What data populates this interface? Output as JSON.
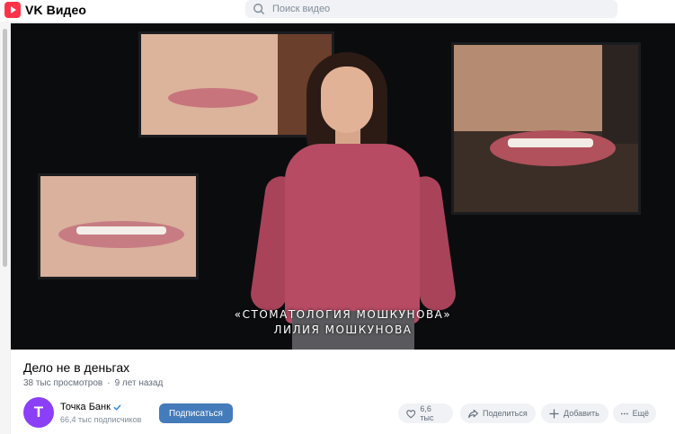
{
  "app": {
    "name": "VK Видео"
  },
  "search": {
    "placeholder": "Поиск видео"
  },
  "player": {
    "subtitle_line1": "«СТОМАТОЛОГИЯ МОШКУНОВА»",
    "subtitle_line2": "ЛИЛИЯ МОШКУНОВА"
  },
  "video": {
    "title": "Дело не в деньгах",
    "views": "38 тыс просмотров",
    "separator": "·",
    "age": "9 лет назад"
  },
  "channel": {
    "avatar_letter": "Т",
    "name": "Точка Банк",
    "subscribers": "66,4 тыс подписчиков",
    "subscribe_label": "Подписаться"
  },
  "actions": {
    "likes": "6,6 тыс",
    "share": "Поделиться",
    "add": "Добавить",
    "more": "Ещё"
  },
  "colors": {
    "brand": "#ff3347",
    "subscribe": "#447bba",
    "avatar": "#8b3ff7",
    "verified": "#2688eb"
  }
}
